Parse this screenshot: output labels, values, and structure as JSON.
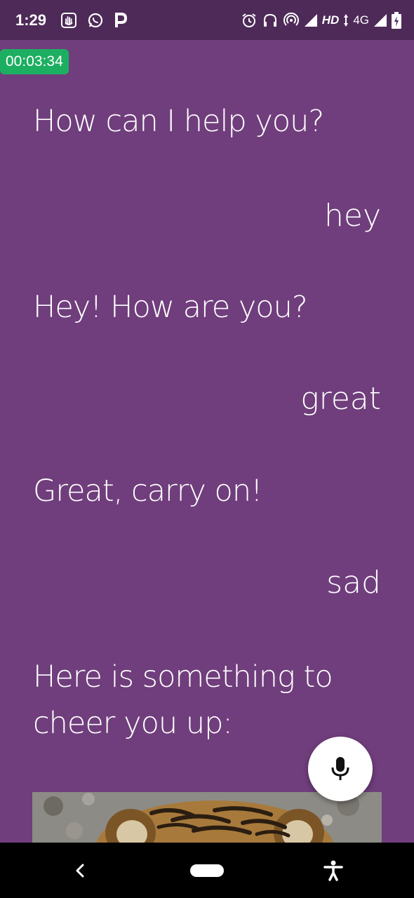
{
  "status_bar": {
    "time": "1:29",
    "network_label": "HD",
    "network_type": "4G",
    "left_icons": [
      "hand-icon",
      "whatsapp-icon",
      "paytm-icon"
    ],
    "right_icons": [
      "alarm-icon",
      "headset-icon",
      "hotspot-icon",
      "signal-icon",
      "signal-icon",
      "battery-charging-icon"
    ]
  },
  "timer": "00:03:34",
  "messages": [
    {
      "role": "bot",
      "text": "How can I help you?"
    },
    {
      "role": "user",
      "text": "hey"
    },
    {
      "role": "bot",
      "text": "Hey! How are you?"
    },
    {
      "role": "user",
      "text": "great"
    },
    {
      "role": "bot",
      "text": "Great, carry on!"
    },
    {
      "role": "user",
      "text": "sad"
    },
    {
      "role": "bot",
      "text": "Here is something to cheer you up:"
    }
  ],
  "cheer_image": {
    "subject": "tiger cub photo"
  },
  "fab": {
    "icon": "microphone-icon"
  },
  "nav_bar": {
    "buttons": [
      "back-icon",
      "home-pill",
      "accessibility-icon"
    ]
  },
  "colors": {
    "background": "#703E7C",
    "status_bar": "#4E2A58",
    "timer_badge": "#1DAF61",
    "text": "#FFFFFF"
  }
}
